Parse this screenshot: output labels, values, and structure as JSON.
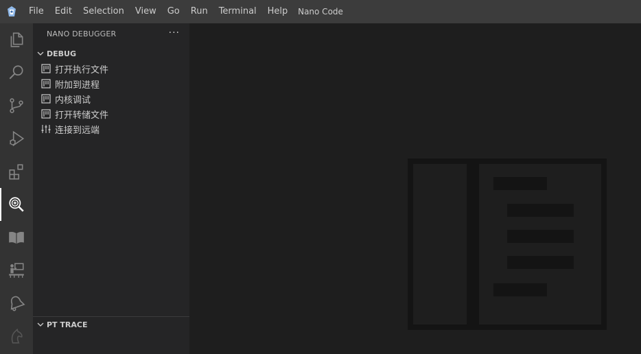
{
  "titlebar": {
    "app_icon": "nano-code-logo-icon",
    "menu": [
      "File",
      "Edit",
      "Selection",
      "View",
      "Go",
      "Run",
      "Terminal",
      "Help"
    ],
    "window_title": "Nano Code"
  },
  "activity_bar": {
    "items": [
      {
        "name": "explorer",
        "icon": "files-icon"
      },
      {
        "name": "search",
        "icon": "search-icon"
      },
      {
        "name": "source-control",
        "icon": "source-control-icon"
      },
      {
        "name": "run-and-debug",
        "icon": "run-debug-icon"
      },
      {
        "name": "extensions",
        "icon": "extensions-icon"
      },
      {
        "name": "nano-debugger",
        "icon": "debugger-magnifier-icon",
        "active": true
      },
      {
        "name": "book",
        "icon": "book-icon"
      },
      {
        "name": "presenter",
        "icon": "presenter-icon"
      },
      {
        "name": "bell",
        "icon": "bell-icon"
      },
      {
        "name": "knight",
        "icon": "knight-icon"
      }
    ]
  },
  "sidebar": {
    "title": "NANO DEBUGGER",
    "more_label": "···",
    "debug_section": {
      "label": "DEBUG",
      "items": [
        {
          "label": "打开执行文件",
          "icon": "panel-icon"
        },
        {
          "label": "附加到进程",
          "icon": "panel-icon"
        },
        {
          "label": "内核调试",
          "icon": "panel-icon"
        },
        {
          "label": "打开转储文件",
          "icon": "panel-icon"
        },
        {
          "label": "连接到远端",
          "icon": "settings-sliders-icon"
        }
      ]
    },
    "pt_trace_section": {
      "label": "PT TRACE"
    }
  },
  "colors": {
    "titlebar_bg": "#3c3c3c",
    "activitybar_bg": "#333333",
    "sidebar_bg": "#252526",
    "editor_bg": "#1e1e1e",
    "watermark": "#141414"
  }
}
